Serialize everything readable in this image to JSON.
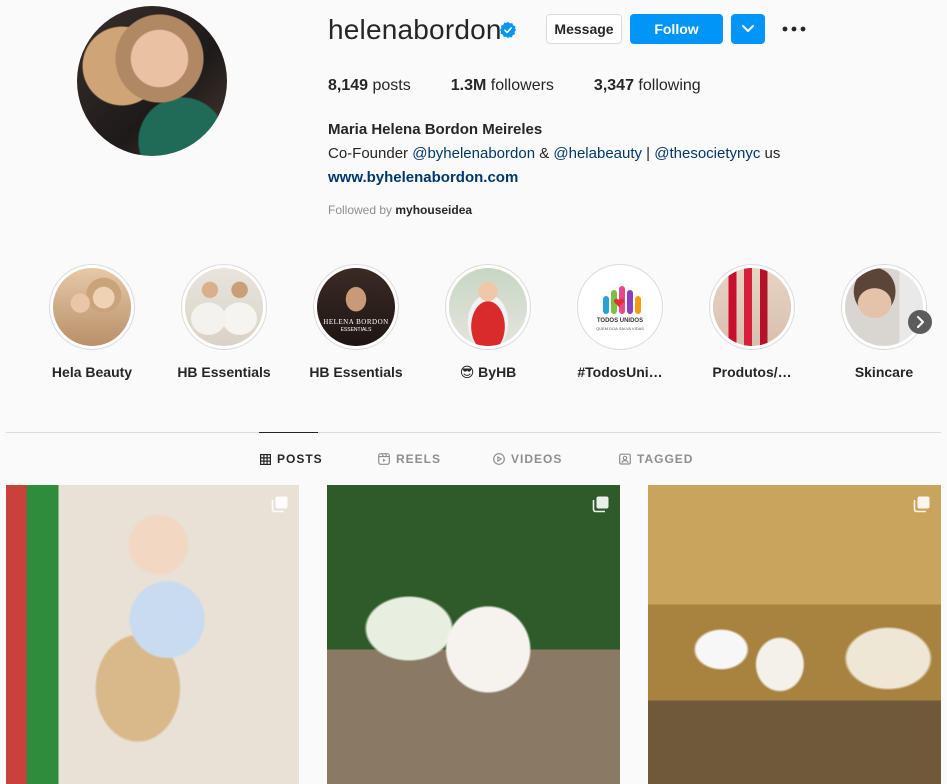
{
  "profile": {
    "username": "helenabordon",
    "message_label": "Message",
    "follow_label": "Follow",
    "full_name": "Maria Helena Bordon Meireles",
    "bio": {
      "prefix": "Co-Founder ",
      "mention1": "@byhelenabordon",
      "sep1": " & ",
      "mention2": "@helabeauty",
      "sep2": " | ",
      "mention3": "@thesocietynyc",
      "suffix": " us"
    },
    "website": "www.byhelenabordon.com",
    "followed_by_label": "Followed by",
    "followed_by_user": "myhouseidea"
  },
  "stats": {
    "posts_count": "8,149",
    "posts_label": "posts",
    "followers_count": "1.3M",
    "followers_label": "followers",
    "following_count": "3,347",
    "following_label": "following"
  },
  "highlights": [
    {
      "label": "Hela Beauty"
    },
    {
      "label": "HB Essentials"
    },
    {
      "label": "HB Essentials"
    },
    {
      "label": "😎 ByHB"
    },
    {
      "label": "#TodosUni…"
    },
    {
      "label": "Produtos/…"
    },
    {
      "label": "Skincare"
    }
  ],
  "tabs": [
    {
      "label": "POSTS",
      "active": true
    },
    {
      "label": "REELS",
      "active": false
    },
    {
      "label": "VIDEOS",
      "active": false
    },
    {
      "label": "TAGGED",
      "active": false
    }
  ],
  "highlight_overlay_text": {
    "hb": "HELENA BORDON",
    "hb_sub": "ESSENTIALS",
    "todos": "TODOS UNIDOS",
    "todos_sub": "QUEM DOA SALVA VIDAS"
  },
  "colors": {
    "follow_blue": "#0095f6",
    "link_blue": "#00376b",
    "muted": "#8e8e8e",
    "border": "#dbdbdb"
  },
  "icons": {
    "verified": "verified-badge-icon",
    "dropdown": "chevron-down-icon",
    "more": "more-options-icon",
    "next": "chevron-right-icon",
    "multi": "carousel-icon"
  }
}
